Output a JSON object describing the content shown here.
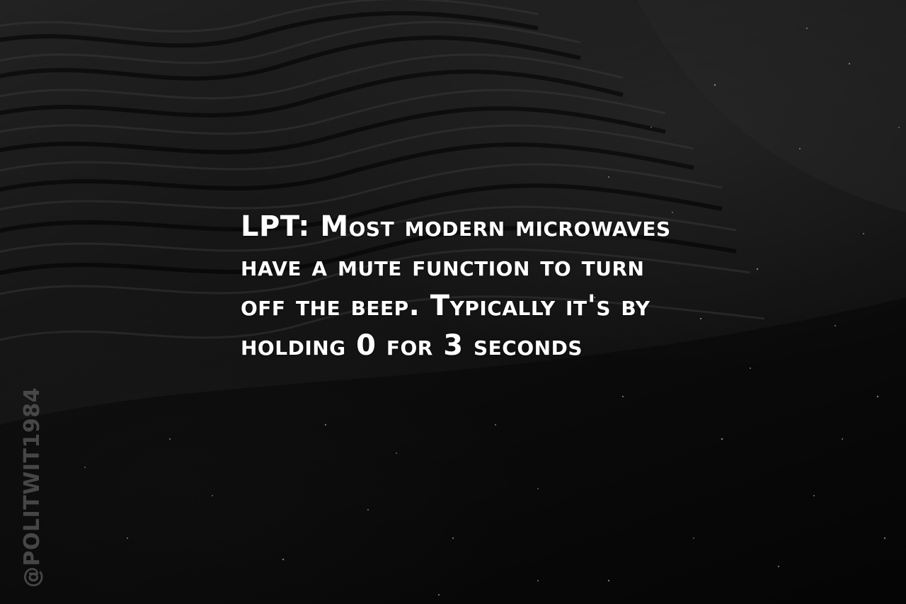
{
  "quote": {
    "text": "LPT: Most modern microwaves have a mute function to turn off the beep. Typically it's by holding 0 for 3 seconds"
  },
  "watermark": {
    "text": "@POLITWIT1984"
  },
  "background": {
    "description_icon": "black-sand-dunes-background",
    "base_color": "#0d0d0d",
    "text_color": "#ffffff",
    "watermark_color": "#5a5a5a"
  }
}
